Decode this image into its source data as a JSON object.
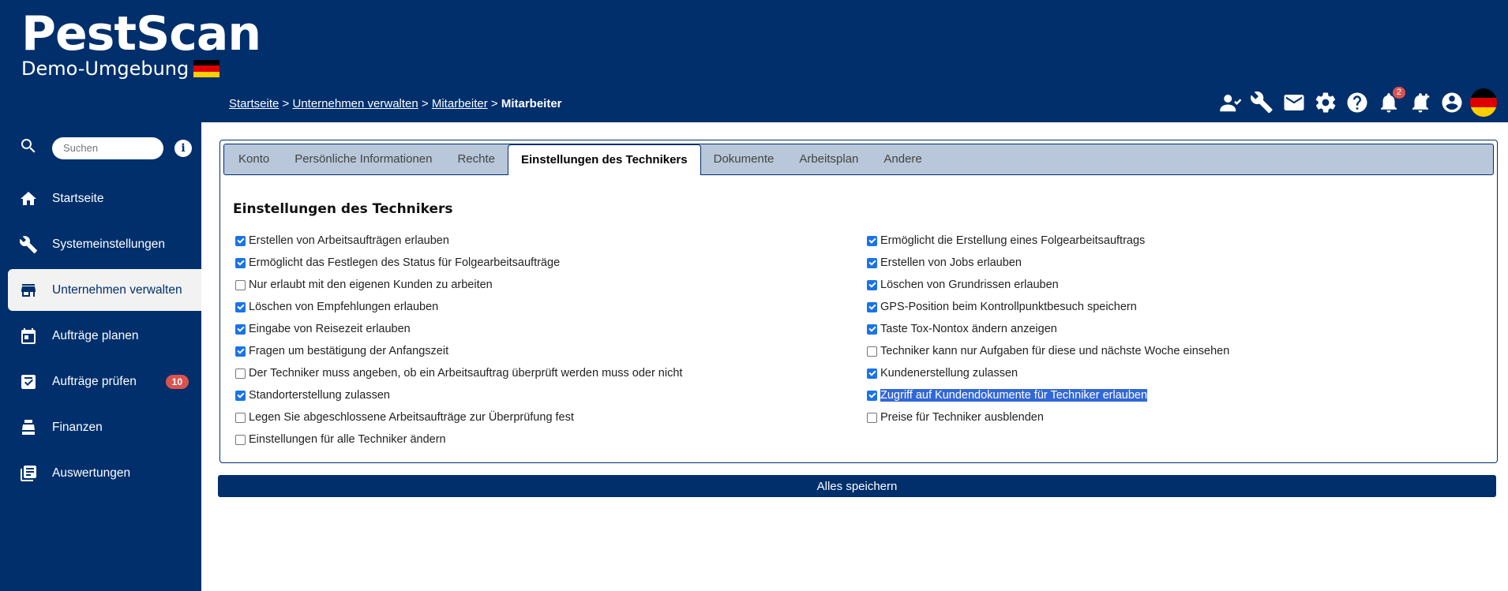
{
  "brand": {
    "title": "PestScan",
    "subtitle": "Demo-Umgebung"
  },
  "breadcrumb": {
    "items": [
      "Startseite",
      "Unternehmen verwalten",
      "Mitarbeiter"
    ],
    "separator": ">",
    "current": "Mitarbeiter"
  },
  "header": {
    "notification_count": "2",
    "icons": [
      "users-icon",
      "tools-icon",
      "mail-icon",
      "gear-icon",
      "help-icon",
      "bell-icon",
      "bell-add-icon",
      "account-icon",
      "language-flag-de"
    ]
  },
  "sidebar": {
    "search_placeholder": "Suchen",
    "items": [
      {
        "label": "Startseite",
        "icon": "home-icon"
      },
      {
        "label": "Systemeinstellungen",
        "icon": "wrench-icon"
      },
      {
        "label": "Unternehmen verwalten",
        "icon": "store-icon",
        "active": true
      },
      {
        "label": "Aufträge planen",
        "icon": "calendar-icon"
      },
      {
        "label": "Aufträge prüfen",
        "icon": "checklist-icon",
        "badge": "10"
      },
      {
        "label": "Finanzen",
        "icon": "cash-register-icon"
      },
      {
        "label": "Auswertungen",
        "icon": "reports-icon"
      }
    ]
  },
  "tabs": [
    "Konto",
    "Persönliche Informationen",
    "Rechte",
    "Einstellungen des Technikers",
    "Dokumente",
    "Arbeitsplan",
    "Andere"
  ],
  "active_tab": "Einstellungen des Technikers",
  "settings": {
    "title": "Einstellungen des Technikers",
    "left": [
      {
        "label": "Erstellen von Arbeitsaufträgen erlauben",
        "checked": true
      },
      {
        "label": "Ermöglicht das Festlegen des Status für Folgearbeitsaufträge",
        "checked": true
      },
      {
        "label": "Nur erlaubt mit den eigenen Kunden zu arbeiten",
        "checked": false
      },
      {
        "label": "Löschen von Empfehlungen erlauben",
        "checked": true
      },
      {
        "label": "Eingabe von Reisezeit erlauben",
        "checked": true
      },
      {
        "label": "Fragen um bestätigung der Anfangszeit",
        "checked": true
      },
      {
        "label": "Der Techniker muss angeben, ob ein Arbeitsauftrag überprüft werden muss oder nicht",
        "checked": false
      },
      {
        "label": "Standorterstellung zulassen",
        "checked": true
      },
      {
        "label": "Legen Sie abgeschlossene Arbeitsaufträge zur Überprüfung fest",
        "checked": false
      },
      {
        "label": "Einstellungen für alle Techniker ändern",
        "checked": false
      }
    ],
    "right": [
      {
        "label": "Ermöglicht die Erstellung eines Folgearbeitsauftrags",
        "checked": true
      },
      {
        "label": "Erstellen von Jobs erlauben",
        "checked": true
      },
      {
        "label": "Löschen von Grundrissen erlauben",
        "checked": true
      },
      {
        "label": "GPS-Position beim Kontrollpunktbesuch speichern",
        "checked": true
      },
      {
        "label": "Taste Tox-Nontox ändern anzeigen",
        "checked": true
      },
      {
        "label": "Techniker kann nur Aufgaben für diese und nächste Woche einsehen",
        "checked": false
      },
      {
        "label": "Kundenerstellung zulassen",
        "checked": true
      },
      {
        "label": "Zugriff auf Kundendokumente für Techniker erlauben",
        "checked": true,
        "selected": true
      },
      {
        "label": "Preise für Techniker ausblenden",
        "checked": false
      }
    ]
  },
  "actions": {
    "save_label": "Alles speichern"
  }
}
